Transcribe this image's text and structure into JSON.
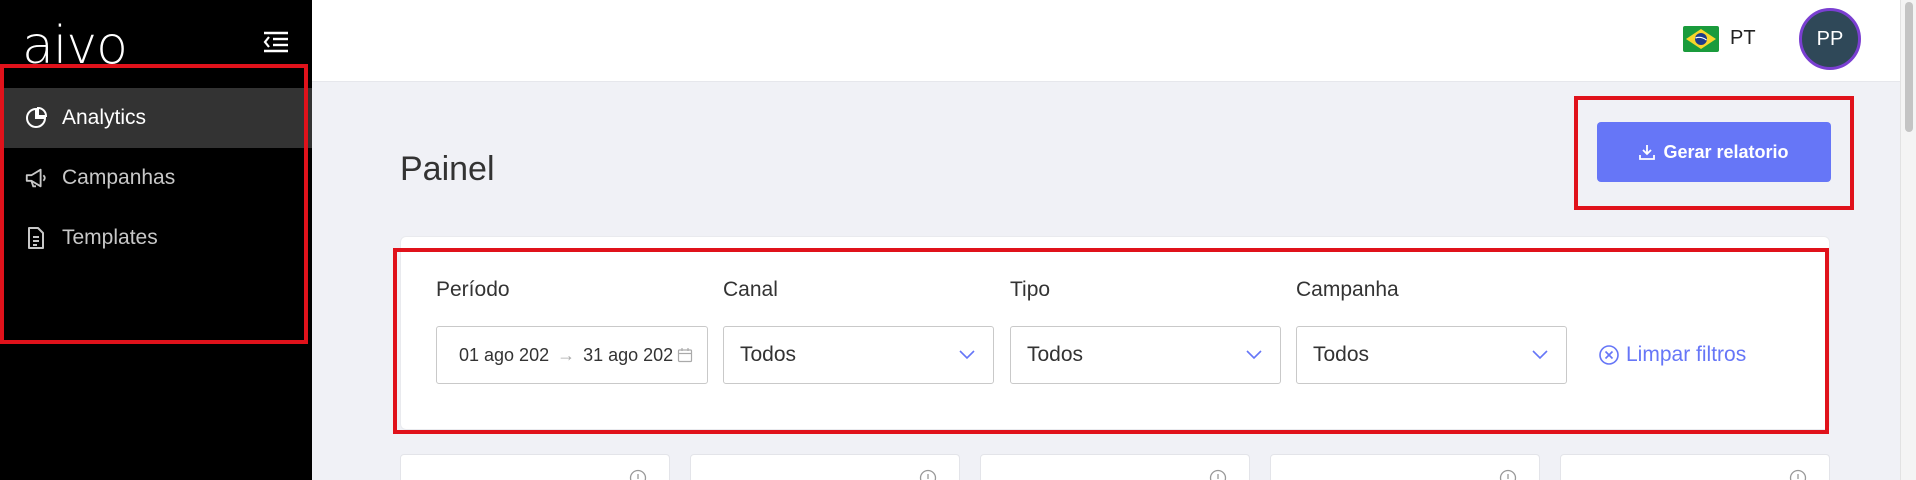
{
  "sidebar": {
    "logo": "aivo",
    "items": [
      {
        "label": "Analytics",
        "icon": "pie-chart-icon",
        "active": true
      },
      {
        "label": "Campanhas",
        "icon": "megaphone-icon",
        "active": false
      },
      {
        "label": "Templates",
        "icon": "document-icon",
        "active": false
      }
    ]
  },
  "header": {
    "language": "PT",
    "flag_icon": "brazil-flag-icon",
    "avatar_initials": "PP"
  },
  "main": {
    "title": "Painel",
    "report_button": "Gerar relatorio",
    "filters": {
      "period": {
        "label": "Período",
        "start": "01 ago 202",
        "end": "31 ago 202"
      },
      "channel": {
        "label": "Canal",
        "value": "Todos"
      },
      "type": {
        "label": "Tipo",
        "value": "Todos"
      },
      "campaign": {
        "label": "Campanha",
        "value": "Todos"
      },
      "clear": "Limpar filtros"
    }
  },
  "colors": {
    "accent": "#6676f7",
    "sidebar_bg": "#000000",
    "highlight": "#e0121b",
    "avatar_bg": "#2f4858"
  }
}
